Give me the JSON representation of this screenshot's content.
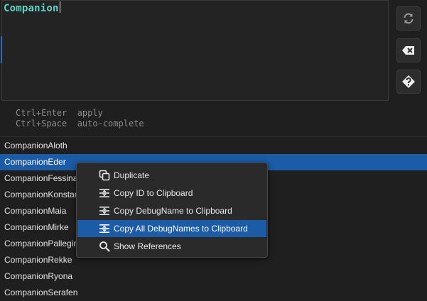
{
  "editor": {
    "query": "Companion"
  },
  "side_buttons": [
    {
      "icon": "refresh-icon"
    },
    {
      "icon": "clear-icon"
    },
    {
      "icon": "help-icon"
    }
  ],
  "hints": [
    {
      "keys": "Ctrl+Enter",
      "action": "apply"
    },
    {
      "keys": "Ctrl+Space",
      "action": "auto-complete"
    }
  ],
  "results": [
    "CompanionAloth",
    "CompanionEder",
    "CompanionFessina",
    "CompanionKonstan",
    "CompanionMaia",
    "CompanionMirke",
    "CompanionPallegin",
    "CompanionRekke",
    "CompanionRyona",
    "CompanionSerafen"
  ],
  "selected_result": "CompanionEder",
  "context_menu": {
    "items": [
      {
        "label": "Duplicate",
        "icon": "duplicate-icon"
      },
      {
        "label": "Copy ID to Clipboard",
        "icon": "copy-icon"
      },
      {
        "label": "Copy DebugName to Clipboard",
        "icon": "copy-icon"
      },
      {
        "label": "Copy All DebugNames to Clipboard",
        "icon": "copy-icon"
      },
      {
        "label": "Show References",
        "icon": "search-icon"
      }
    ],
    "highlighted": "Copy All DebugNames to Clipboard"
  },
  "colors": {
    "accent": "#1c5ba6",
    "query_text": "#5fd3c5",
    "background": "#1f1f1f"
  }
}
